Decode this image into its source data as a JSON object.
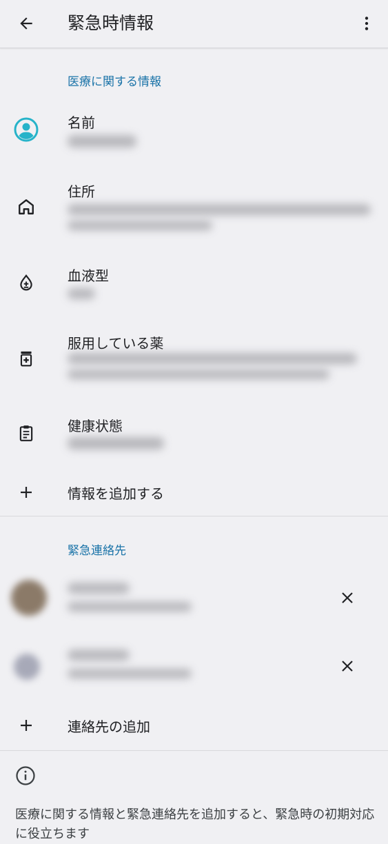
{
  "appbar": {
    "title": "緊急時情報",
    "back_icon": "arrow-back-icon",
    "more_icon": "more-vert-icon"
  },
  "medical": {
    "section_title": "医療に関する情報",
    "name_label": "名前",
    "address_label": "住所",
    "blood_label": "血液型",
    "medication_label": "服用している薬",
    "condition_label": "健康状態",
    "add_info_label": "情報を追加する"
  },
  "contacts": {
    "section_title": "緊急連絡先",
    "add_contact_label": "連絡先の追加"
  },
  "footer": {
    "text": "医療に関する情報と緊急連絡先を追加すると、緊急時の初期対応に役立ちます"
  },
  "colors": {
    "accent": "#1a73a8",
    "avatar_teal": "#26b3c9",
    "background": "#f0f0f3"
  }
}
